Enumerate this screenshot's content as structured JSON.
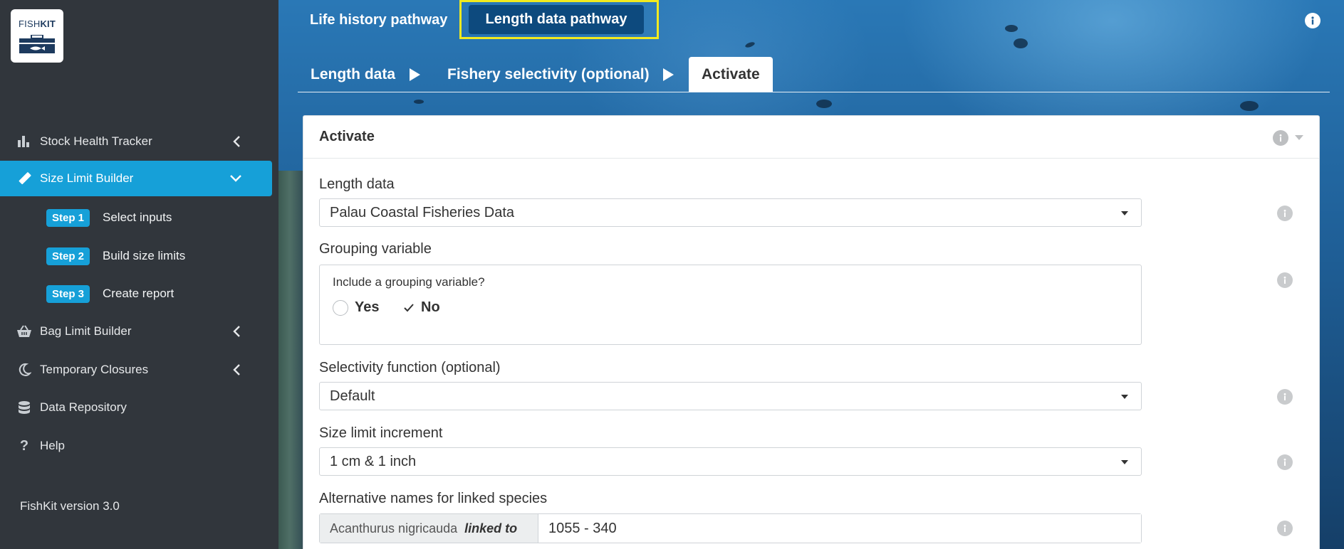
{
  "sidebar": {
    "logo": {
      "text_prefix": "FISH",
      "text_bold": "KIT",
      "icon": "tackle-box-icon"
    },
    "items": [
      {
        "label": "Stock Health Tracker",
        "icon": "bar-chart-icon",
        "chevron": "chevron-left-icon"
      },
      {
        "label": "Size Limit Builder",
        "icon": "ruler-icon",
        "chevron": "chevron-down-icon"
      },
      {
        "label": "Bag Limit Builder",
        "icon": "basket-icon",
        "chevron": "chevron-left-icon"
      },
      {
        "label": "Temporary Closures",
        "icon": "moon-icon",
        "chevron": "chevron-left-icon"
      },
      {
        "label": "Data Repository",
        "icon": "database-icon"
      },
      {
        "label": "Help",
        "icon": "question-icon"
      }
    ],
    "steps": [
      {
        "badge": "Step 1",
        "label": "Select inputs"
      },
      {
        "badge": "Step 2",
        "label": "Build size limits"
      },
      {
        "badge": "Step 3",
        "label": "Create report"
      }
    ],
    "version": "FishKit version 3.0"
  },
  "pathway_tabs": {
    "life_history": "Life history pathway",
    "length_data": "Length data pathway"
  },
  "wizard_tabs": {
    "length_data": "Length data",
    "fishery_selectivity": "Fishery selectivity (optional)",
    "activate": "Activate"
  },
  "panel": {
    "title": "Activate",
    "length_data": {
      "label": "Length data",
      "value": "Palau Coastal Fisheries Data"
    },
    "grouping": {
      "label": "Grouping variable",
      "question": "Include a grouping variable?",
      "yes": "Yes",
      "no": "No"
    },
    "selectivity": {
      "label": "Selectivity function (optional)",
      "value": "Default"
    },
    "increment": {
      "label": "Size limit increment",
      "value": "1 cm & 1 inch"
    },
    "alt_names": {
      "label": "Alternative names for linked species",
      "species": "Acanthurus nigricauda",
      "linked_to": "linked to",
      "value": "1055 - 340"
    }
  },
  "colors": {
    "sidebar_bg": "#31363c",
    "accent": "#16a0d8",
    "selected_tab": "#0d4a7e",
    "highlight": "#f2ea1f"
  }
}
